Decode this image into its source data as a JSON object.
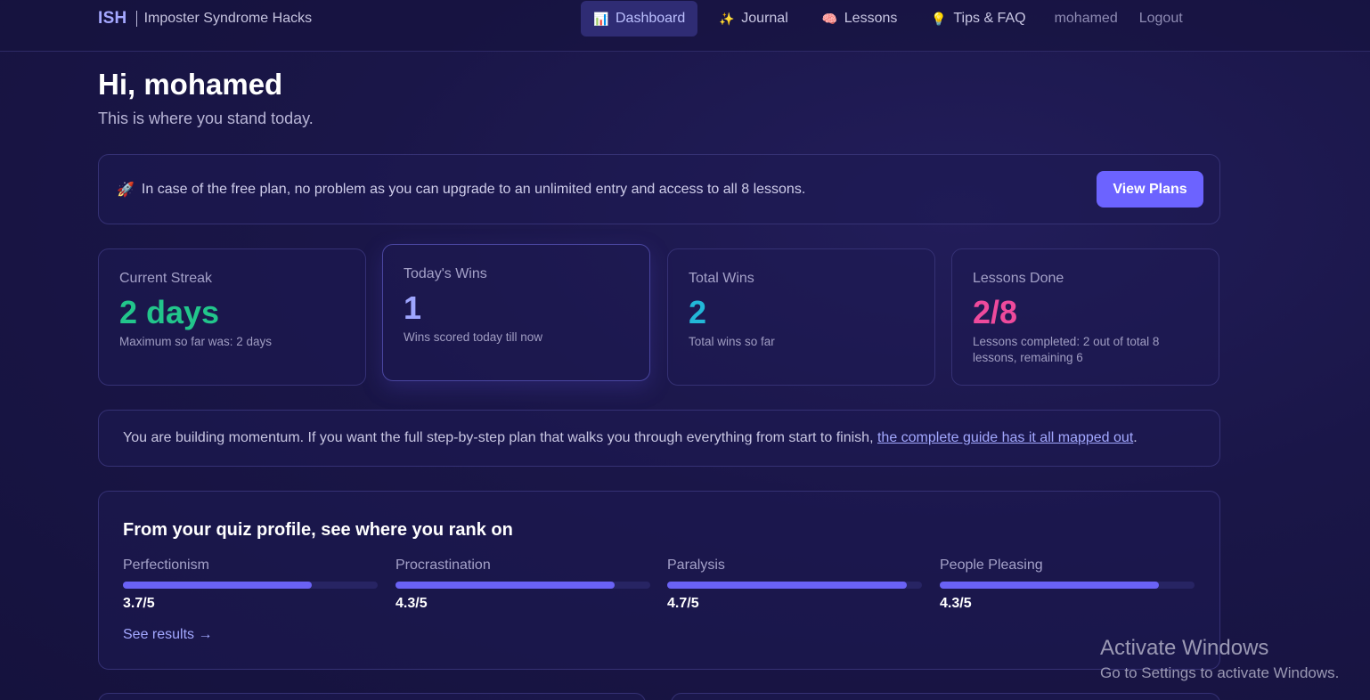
{
  "nav": {
    "brand_short": "ISH",
    "brand_long": "Imposter Syndrome Hacks",
    "items": [
      {
        "label": "Dashboard",
        "icon": "📊"
      },
      {
        "label": "Journal",
        "icon": "✨"
      },
      {
        "label": "Lessons",
        "icon": "🧠"
      },
      {
        "label": "Tips & FAQ",
        "icon": "💡"
      }
    ],
    "user": "mohamed",
    "logout": "Logout"
  },
  "header": {
    "greeting": "Hi, mohamed",
    "subtitle": "This is where you stand today."
  },
  "banner": {
    "icon": "🚀",
    "text": "In case of the free plan, no problem as you can upgrade to an unlimited entry and access to all 8 lessons.",
    "button": "View Plans"
  },
  "stats": [
    {
      "label": "Current Streak",
      "value": "2 days",
      "note": "Maximum so far was: 2 days",
      "color": "#22c58b"
    },
    {
      "label": "Today's Wins",
      "value": "1",
      "note": "Wins scored today till now",
      "color": "#9fa6ff"
    },
    {
      "label": "Total Wins",
      "value": "2",
      "note": "Total wins so far",
      "color": "#22b8d8"
    },
    {
      "label": "Lessons Done",
      "value": "2/8",
      "note": "Lessons completed: 2 out of total 8 lessons, remaining 6",
      "color": "#ee4a9c"
    }
  ],
  "momentum": {
    "text": "You are building momentum. If you want the full step-by-step plan that walks you through everything from start to finish, ",
    "link": "the complete guide has it all mapped out",
    "end": "."
  },
  "quiz": {
    "title": "From your quiz profile, see where you rank on",
    "traits": [
      {
        "name": "Perfectionism",
        "score": "3.7/5",
        "value": 3.7
      },
      {
        "name": "Procrastination",
        "score": "4.3/5",
        "value": 4.3
      },
      {
        "name": "Paralysis",
        "score": "4.7/5",
        "value": 4.7
      },
      {
        "name": "People Pleasing",
        "score": "4.3/5",
        "value": 4.3
      }
    ],
    "see_results": "See results →"
  },
  "watermark": {
    "line1": "Activate Windows",
    "line2": "Go to Settings to activate Windows."
  }
}
